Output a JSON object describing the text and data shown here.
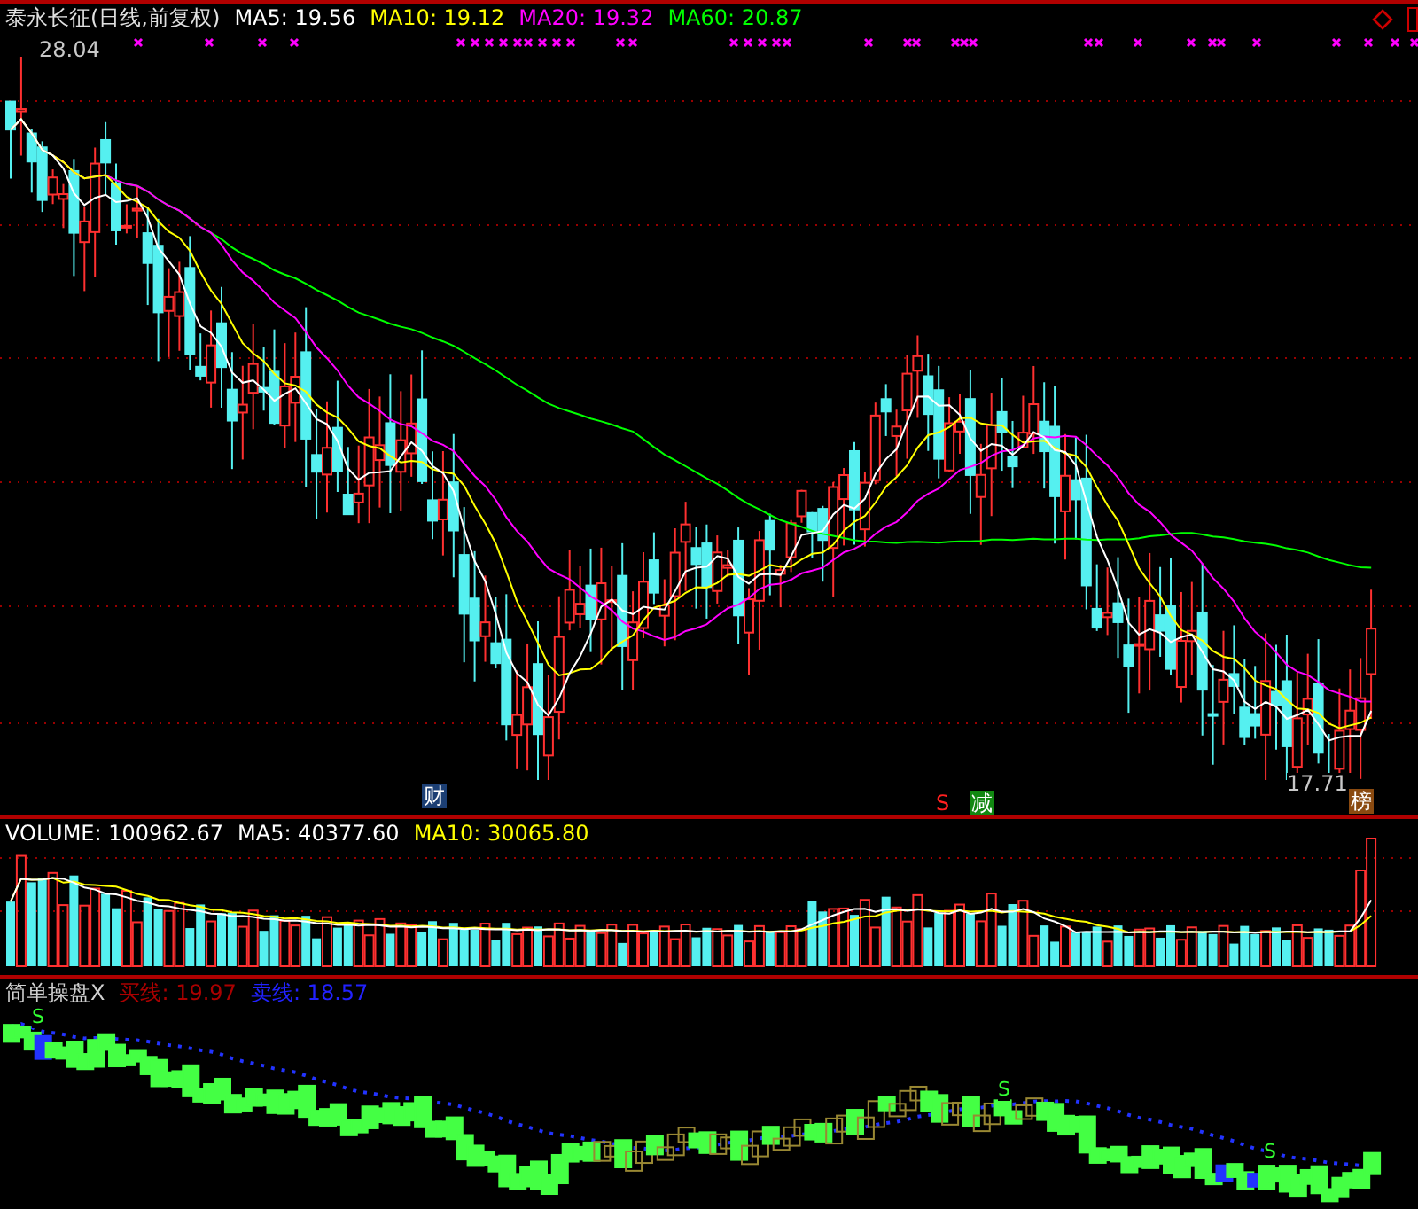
{
  "price_chart": {
    "title": "泰永长征(日线,前复权)",
    "indicators": [
      {
        "label": "MA5: 19.56",
        "color": "#ffffff"
      },
      {
        "label": "MA10: 19.12",
        "color": "#ffff00"
      },
      {
        "label": "MA20: 19.32",
        "color": "#ff00ff"
      },
      {
        "label": "MA60: 20.87",
        "color": "#00ff00"
      }
    ],
    "high_label": "28.04",
    "low_label": "17.71",
    "markers": [
      {
        "text": "财",
        "color": "#1c3f74"
      },
      {
        "text": "S",
        "color": "#000000"
      },
      {
        "text": "减",
        "color": "#118811"
      },
      {
        "text": "榜",
        "color": "#8a4a10"
      }
    ]
  },
  "volume": {
    "indicators": [
      {
        "label": "VOLUME: 100962.67",
        "color": "#ffffff"
      },
      {
        "label": "MA5: 40377.60",
        "color": "#ffffff"
      },
      {
        "label": "MA10: 30065.80",
        "color": "#ffff00"
      }
    ]
  },
  "indicator": {
    "name": "简单操盘X",
    "readings": [
      {
        "label": "买线: 19.97",
        "color": "#aa0000"
      },
      {
        "label": "卖线: 18.57",
        "color": "#2222ff"
      }
    ],
    "signals": [
      {
        "text": "S"
      },
      {
        "text": "S"
      },
      {
        "text": "S"
      }
    ]
  }
}
